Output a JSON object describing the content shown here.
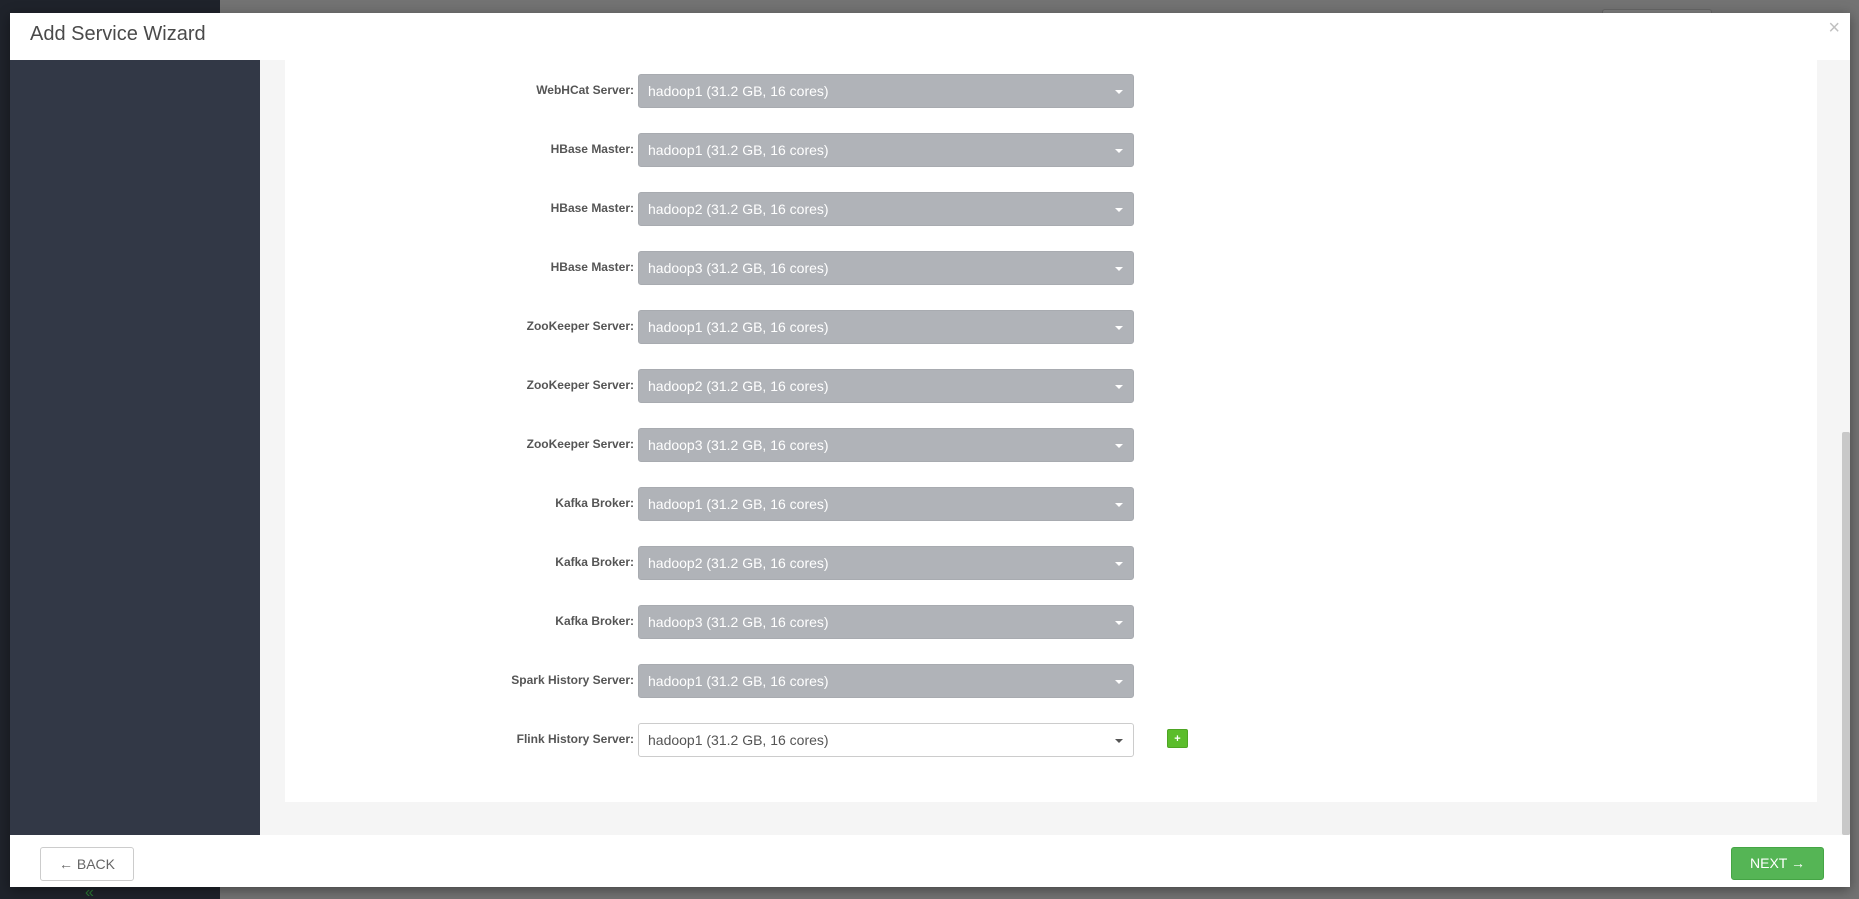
{
  "modal": {
    "title": "Add Service Wizard",
    "close_symbol": "×"
  },
  "assignments": [
    {
      "label": "WebHCat Server:",
      "value": "hadoop1 (31.2 GB, 16 cores)",
      "active": false
    },
    {
      "label": "HBase Master:",
      "value": "hadoop1 (31.2 GB, 16 cores)",
      "active": false
    },
    {
      "label": "HBase Master:",
      "value": "hadoop2 (31.2 GB, 16 cores)",
      "active": false
    },
    {
      "label": "HBase Master:",
      "value": "hadoop3 (31.2 GB, 16 cores)",
      "active": false
    },
    {
      "label": "ZooKeeper Server:",
      "value": "hadoop1 (31.2 GB, 16 cores)",
      "active": false
    },
    {
      "label": "ZooKeeper Server:",
      "value": "hadoop2 (31.2 GB, 16 cores)",
      "active": false
    },
    {
      "label": "ZooKeeper Server:",
      "value": "hadoop3 (31.2 GB, 16 cores)",
      "active": false
    },
    {
      "label": "Kafka Broker:",
      "value": "hadoop1 (31.2 GB, 16 cores)",
      "active": false
    },
    {
      "label": "Kafka Broker:",
      "value": "hadoop2 (31.2 GB, 16 cores)",
      "active": false
    },
    {
      "label": "Kafka Broker:",
      "value": "hadoop3 (31.2 GB, 16 cores)",
      "active": false
    },
    {
      "label": "Spark History Server:",
      "value": "hadoop1 (31.2 GB, 16 cores)",
      "active": false
    },
    {
      "label": "Flink History Server:",
      "value": "hadoop1 (31.2 GB, 16 cores)",
      "active": true
    }
  ],
  "add_button": {
    "label": "+"
  },
  "footer": {
    "back_label": "← BACK",
    "next_label": "NEXT →"
  },
  "icons": {
    "caret": "caret-down-icon",
    "collapse": "double-chevron-left-icon"
  },
  "colors": {
    "wizard_nav": "#323846",
    "select_disabled": "#b0b3b8",
    "next_button": "#55b555",
    "add_button": "#5bbd2b"
  }
}
